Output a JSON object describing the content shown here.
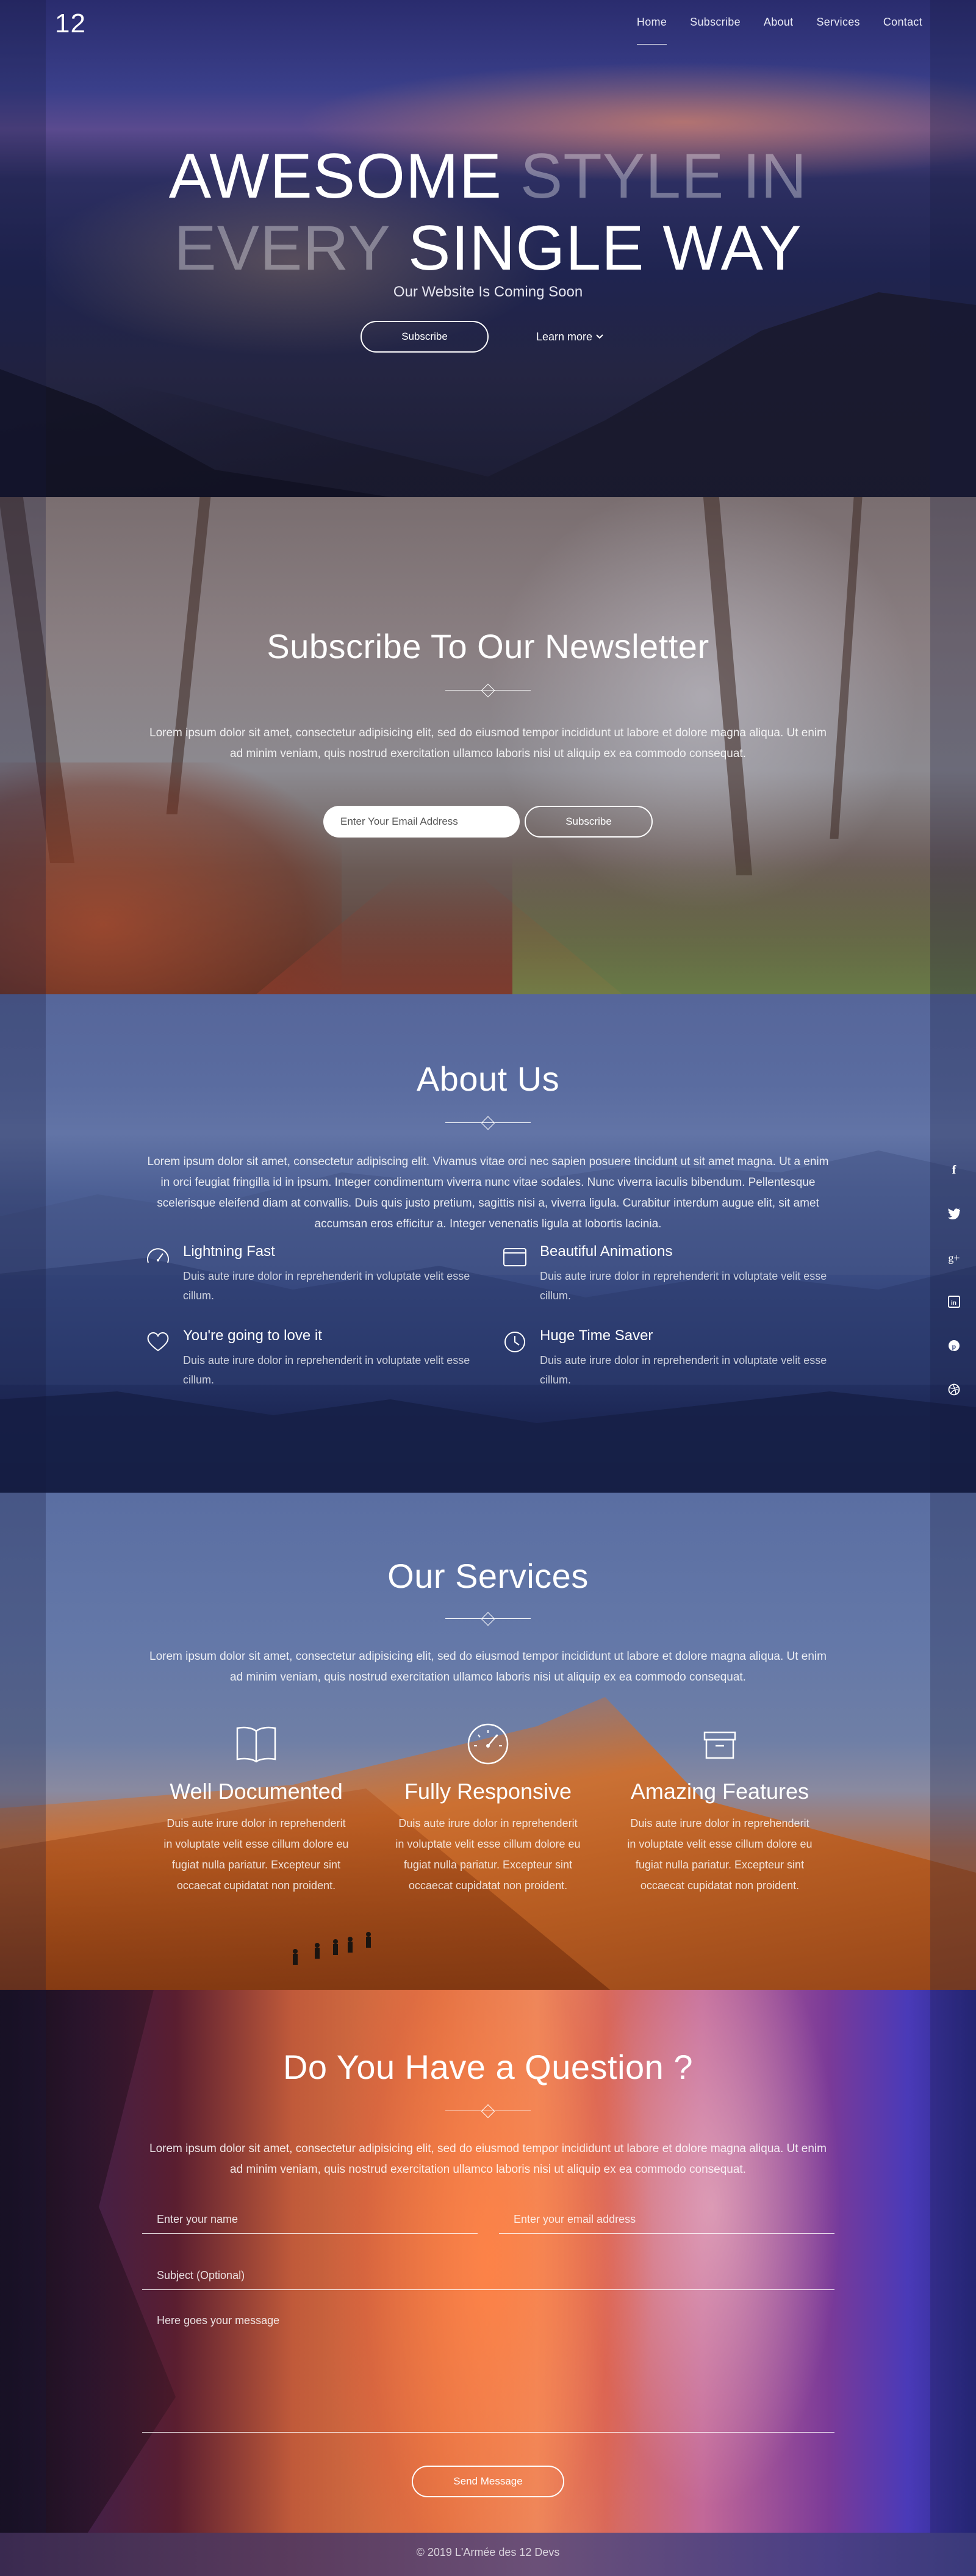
{
  "brand": {
    "logo": "12"
  },
  "nav": {
    "items": [
      {
        "label": "Home"
      },
      {
        "label": "Subscribe"
      },
      {
        "label": "About"
      },
      {
        "label": "Services"
      },
      {
        "label": "Contact"
      }
    ],
    "active": "Home"
  },
  "hero": {
    "title_line1_bold": "AWESOME",
    "title_line1_thin": " STYLE IN",
    "title_line2_thin": "EVERY ",
    "title_line2_bold": "SINGLE WAY",
    "subtitle": "Our Website Is Coming Soon",
    "subscribe_button": "Subscribe",
    "learn_more_link": "Learn more",
    "learn_more_icon": "chevron-down-icon"
  },
  "newsletter": {
    "title": "Subscribe To Our Newsletter",
    "text": "Lorem ipsum dolor sit amet, consectetur adipisicing elit, sed do eiusmod tempor incididunt ut labore et dolore magna aliqua. Ut enim ad minim veniam, quis nostrud exercitation ullamco laboris nisi ut aliquip ex ea commodo consequat.",
    "email_placeholder": "Enter Your Email Address",
    "button": "Subscribe"
  },
  "about": {
    "title": "About Us",
    "text": "Lorem ipsum dolor sit amet, consectetur adipiscing elit. Vivamus vitae orci nec sapien posuere tincidunt ut sit amet magna. Ut a enim in orci feugiat fringilla id in ipsum. Integer condimentum viverra nunc vitae sodales. Nunc viverra iaculis bibendum. Pellentesque scelerisque eleifend diam at convallis. Duis quis justo pretium, sagittis nisi a, viverra ligula. Curabitur interdum augue elit, sit amet accumsan eros efficitur a. Integer venenatis ligula at lobortis lacinia.",
    "features": [
      {
        "icon": "speedometer-icon",
        "title": "Lightning Fast",
        "text": "Duis aute irure dolor in reprehenderit in voluptate velit esse cillum."
      },
      {
        "icon": "browser-window-icon",
        "title": "Beautiful Animations",
        "text": "Duis aute irure dolor in reprehenderit in voluptate velit esse cillum."
      },
      {
        "icon": "heart-icon",
        "title": "You're going to love it",
        "text": "Duis aute irure dolor in reprehenderit in voluptate velit esse cillum."
      },
      {
        "icon": "clock-icon",
        "title": "Huge Time Saver",
        "text": "Duis aute irure dolor in reprehenderit in voluptate velit esse cillum."
      }
    ]
  },
  "social": [
    {
      "icon": "facebook-icon",
      "glyph": "f"
    },
    {
      "icon": "twitter-icon",
      "glyph": "🐦"
    },
    {
      "icon": "google-plus-icon",
      "glyph": "g+"
    },
    {
      "icon": "linkedin-icon",
      "glyph": "in"
    },
    {
      "icon": "pinterest-icon",
      "glyph": "p"
    },
    {
      "icon": "dribbble-icon",
      "glyph": "◍"
    }
  ],
  "services": {
    "title": "Our Services",
    "text": "Lorem ipsum dolor sit amet, consectetur adipisicing elit, sed do eiusmod tempor incididunt ut labore et dolore magna aliqua. Ut enim ad minim veniam, quis nostrud exercitation ullamco laboris nisi ut aliquip ex ea commodo consequat.",
    "items": [
      {
        "icon": "open-book-icon",
        "title": "Well Documented",
        "text": "Duis aute irure dolor in reprehenderit in voluptate velit esse cillum dolore eu fugiat nulla pariatur. Excepteur sint occaecat cupidatat non proident."
      },
      {
        "icon": "gauge-icon",
        "title": "Fully Responsive",
        "text": "Duis aute irure dolor in reprehenderit in voluptate velit esse cillum dolore eu fugiat nulla pariatur. Excepteur sint occaecat cupidatat non proident."
      },
      {
        "icon": "archive-box-icon",
        "title": "Amazing Features",
        "text": "Duis aute irure dolor in reprehenderit in voluptate velit esse cillum dolore eu fugiat nulla pariatur. Excepteur sint occaecat cupidatat non proident."
      }
    ]
  },
  "contact": {
    "title": "Do You Have a Question ?",
    "text": "Lorem ipsum dolor sit amet, consectetur adipisicing elit, sed do eiusmod tempor incididunt ut labore et dolore magna aliqua. Ut enim ad minim veniam, quis nostrud exercitation ullamco laboris nisi ut aliquip ex ea commodo consequat.",
    "name_placeholder": "Enter your name",
    "email_placeholder": "Enter your email address",
    "subject_placeholder": "Subject (Optional)",
    "message_placeholder": "Here goes your message",
    "button": "Send Message"
  },
  "footer": {
    "text": "© 2019 L'Armée des 12 Devs"
  }
}
